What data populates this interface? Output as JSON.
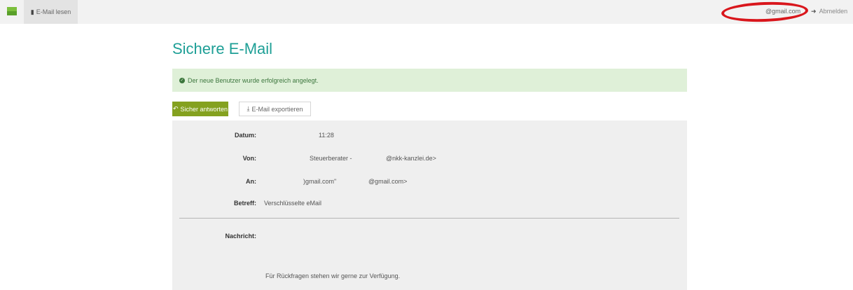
{
  "navbar": {
    "read_label": "E-Mail lesen",
    "read_icon": "book-icon",
    "user_email": "@gmail.com",
    "logout_label": "Abmelden",
    "logout_icon": "sign-out-icon",
    "brand_color": "#7cbf3c"
  },
  "page": {
    "title": "Sichere E-Mail",
    "title_color": "#1e9f96"
  },
  "alert": {
    "text": "Der neue Benutzer wurde erfolgreich angelegt.",
    "icon": "check-circle-icon"
  },
  "toolbar": {
    "reply_label": "Sicher antworten",
    "reply_icon": "reply-icon",
    "reply_color": "#84a11f",
    "export_label": "E-Mail exportieren",
    "export_icon": "download-icon"
  },
  "mail": {
    "date_label": "Datum:",
    "date_value": "11:28",
    "from_label": "Von:",
    "from_name": "Steuerberater -",
    "from_address": "@nkk-kanzlei.de>",
    "to_label": "An:",
    "to_name": ")gmail.com\"",
    "to_address": "@gmail.com>",
    "subject_label": "Betreff:",
    "subject_value": "Verschlüsselte eMail",
    "message_label": "Nachricht:",
    "message_text": "Für Rückfragen stehen wir gerne zur Verfügung."
  },
  "annotation": {
    "highlight_color": "#d9161c"
  }
}
